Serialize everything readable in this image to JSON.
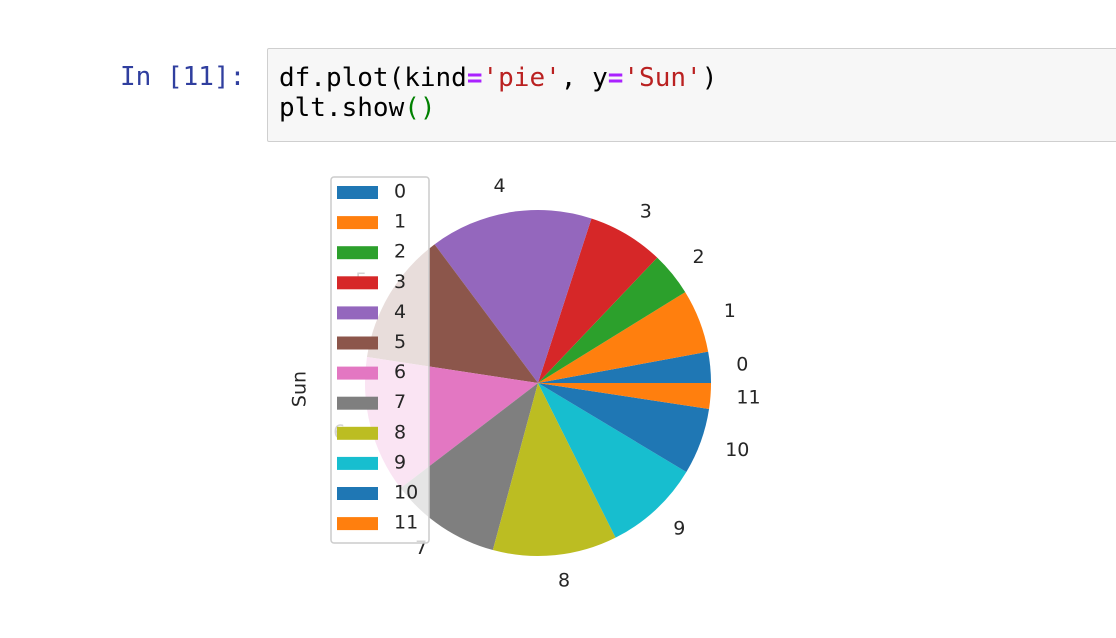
{
  "notebook": {
    "prompt": "In [11]:",
    "code": {
      "line1": {
        "a": "df.plot(kind",
        "eq1": "=",
        "s1": "'pie'",
        "b": ", y",
        "eq2": "=",
        "s2": "'Sun'",
        "c": ")"
      },
      "line2": {
        "a": "plt.show",
        "paren": "()"
      }
    }
  },
  "chart_data": {
    "type": "pie",
    "ylabel": "Sun",
    "start_angle_deg": 0,
    "direction": "counterclockwise",
    "legend": {
      "location": "upper-left",
      "entries": [
        "0",
        "1",
        "2",
        "3",
        "4",
        "5",
        "6",
        "7",
        "8",
        "9",
        "10",
        "11"
      ]
    },
    "labels": [
      "0",
      "1",
      "2",
      "3",
      "4",
      "5",
      "6",
      "7",
      "8",
      "9",
      "10",
      "11"
    ],
    "values": [
      0.029,
      0.059,
      0.041,
      0.071,
      0.152,
      0.124,
      0.128,
      0.104,
      0.116,
      0.09,
      0.062,
      0.024
    ],
    "colors": [
      "#1f77b4",
      "#ff7f0e",
      "#2ca02c",
      "#d62728",
      "#9467bd",
      "#8c564b",
      "#e377c2",
      "#7f7f7f",
      "#bcbd22",
      "#17becf",
      "#1f77b4",
      "#ff7f0e"
    ]
  }
}
